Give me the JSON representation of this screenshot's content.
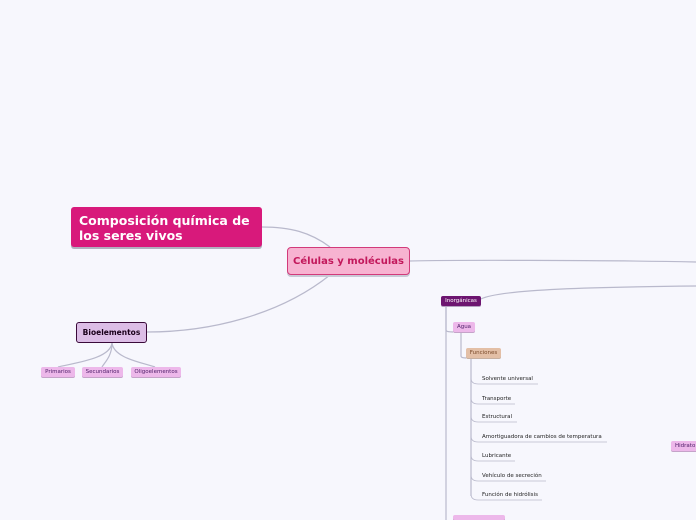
{
  "central": {
    "label": "Células y moléculas"
  },
  "main_topic": {
    "label": "Composición química de los seres vivos"
  },
  "bioelementos": {
    "label": "Bioelementos",
    "children": [
      "Primarios",
      "Secundarios",
      "Oligoelementos"
    ]
  },
  "inorganicas": {
    "label": "Inorgánicas"
  },
  "agua": {
    "label": "Agua"
  },
  "funciones": {
    "label": "Funciones",
    "items": [
      "Solvente universal",
      "Transporte",
      "Estructural",
      "Amortiguadora de cambios de temperatura",
      "Lubricante",
      "Vehículo de secreción",
      "Función de hidrólisis"
    ]
  },
  "hidrato": {
    "label": "Hidrato"
  },
  "colors": {
    "link": "#b9b9cc",
    "main_topic": "#d8197b",
    "central_fill": "#f7b3d1",
    "bio_fill": "#dcbde6",
    "inorganicas_fill": "#6d1570",
    "agua_fill": "#edb8ea",
    "funciones_fill": "#e3bfa6"
  }
}
